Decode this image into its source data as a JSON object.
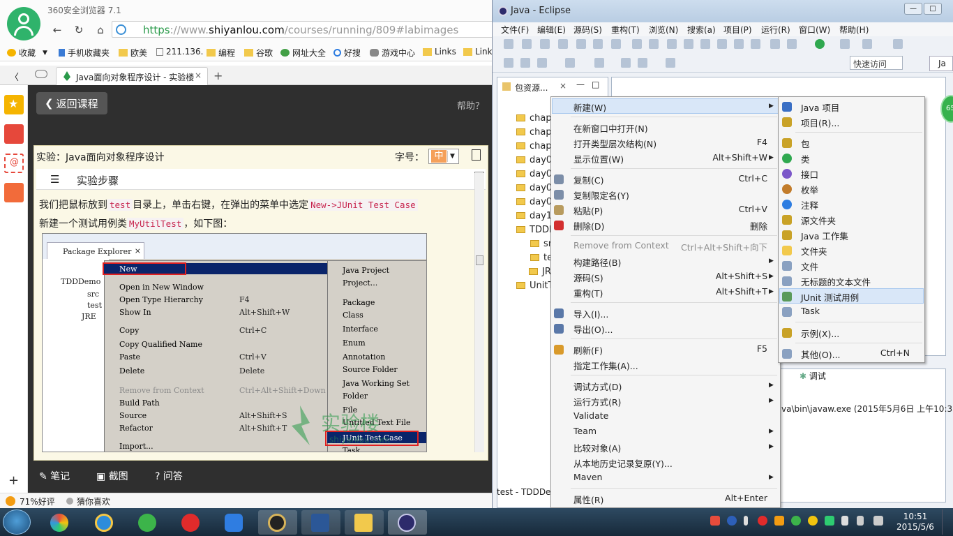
{
  "browser": {
    "title": "360安全浏览器 7.1",
    "url": {
      "scheme": "https",
      "sep": "://www.",
      "host": "shiyanlou.com",
      "path": "/courses/running/809#labimages"
    },
    "bookmarks": [
      "收藏",
      "手机收藏夹",
      "欧美",
      "211.136.",
      "编程",
      "谷歌",
      "网址大全",
      "好搜",
      "游戏中心",
      "Links",
      "Link"
    ],
    "tab_title": "Java面向对象程序设计 - 实验楼",
    "page": {
      "back_label": "返回课程",
      "help_label": "帮助？",
      "lab_title": "实验：Java面向对象程序设计",
      "font_label": "字号：",
      "font_value": "中",
      "steps_label": "实验步骤",
      "para1_a": "我们把鼠标放到",
      "para1_code1": "test",
      "para1_b": "目录上，单击右键，在弹出的菜单中选定",
      "para1_code2": "New->JUnit Test Case",
      "para2_a": "新建一个测试用例类",
      "para2_code": "MyUtilTest",
      "para2_b": "，如下图："
    },
    "bottom": {
      "notes": "笔记",
      "screenshot": "截图",
      "qa": "问答"
    },
    "status": {
      "rating": "71%好评",
      "guess": "猜你喜欢"
    },
    "inner_screenshot": {
      "tab": "Package Explorer",
      "tree": [
        "TDDDemo",
        "src",
        "test",
        "JRE"
      ],
      "menu1": [
        {
          "l": "New",
          "s": ""
        },
        {
          "l": "Open in New Window",
          "s": ""
        },
        {
          "l": "Open Type Hierarchy",
          "s": "F4"
        },
        {
          "l": "Show In",
          "s": "Alt+Shift+W"
        },
        {
          "l": "Copy",
          "s": "Ctrl+C"
        },
        {
          "l": "Copy Qualified Name",
          "s": ""
        },
        {
          "l": "Paste",
          "s": "Ctrl+V"
        },
        {
          "l": "Delete",
          "s": "Delete"
        },
        {
          "l": "Remove from Context",
          "s": "Ctrl+Alt+Shift+Down"
        },
        {
          "l": "Build Path",
          "s": ""
        },
        {
          "l": "Source",
          "s": "Alt+Shift+S"
        },
        {
          "l": "Refactor",
          "s": "Alt+Shift+T"
        },
        {
          "l": "Import...",
          "s": ""
        }
      ],
      "menu2": [
        "Java Project",
        "Project...",
        "Package",
        "Class",
        "Interface",
        "Enum",
        "Annotation",
        "Source Folder",
        "Java Working Set",
        "Folder",
        "File",
        "Untitled Text File",
        "JUnit Test Case",
        "Task"
      ]
    },
    "watermark": {
      "cn": "实验楼",
      "en": "shiyanlou.com"
    }
  },
  "eclipse": {
    "title": "Java - Eclipse",
    "menus": [
      "文件(F)",
      "编辑(E)",
      "源码(S)",
      "重构(T)",
      "浏览(N)",
      "搜索(a)",
      "项目(P)",
      "运行(R)",
      "窗口(W)",
      "帮助(H)"
    ],
    "quick_access": "快速访问",
    "perspective": "Ja",
    "pkg_tab": "包资源...",
    "tree": [
      "chap",
      "chap",
      "chap",
      "day0",
      "day0",
      "day0",
      "day0",
      "day1",
      "TDDI",
      "sr",
      "te",
      "JR",
      "UnitT"
    ],
    "console_tab": "调试",
    "console_line": "va\\bin\\javaw.exe (2015年5月6日 上午10:3",
    "status_text": "test - TDDDe",
    "badge": "65",
    "context_menu": [
      {
        "l": "新建(W)",
        "s": "",
        "sub": true
      },
      {
        "l": "在新窗口中打开(N)",
        "s": ""
      },
      {
        "l": "打开类型层次结构(N)",
        "s": "F4"
      },
      {
        "l": "显示位置(W)",
        "s": "Alt+Shift+W",
        "sub": true
      },
      {
        "l": "复制(C)",
        "s": "Ctrl+C"
      },
      {
        "l": "复制限定名(Y)",
        "s": ""
      },
      {
        "l": "粘贴(P)",
        "s": "Ctrl+V"
      },
      {
        "l": "删除(D)",
        "s": "删除"
      },
      {
        "l": "Remove from Context",
        "s": "Ctrl+Alt+Shift+向下",
        "dis": true
      },
      {
        "l": "构建路径(B)",
        "s": "",
        "sub": true
      },
      {
        "l": "源码(S)",
        "s": "Alt+Shift+S",
        "sub": true
      },
      {
        "l": "重构(T)",
        "s": "Alt+Shift+T",
        "sub": true
      },
      {
        "l": "导入(I)...",
        "s": ""
      },
      {
        "l": "导出(O)...",
        "s": ""
      },
      {
        "l": "刷新(F)",
        "s": "F5"
      },
      {
        "l": "指定工作集(A)...",
        "s": ""
      },
      {
        "l": "调试方式(D)",
        "s": "",
        "sub": true
      },
      {
        "l": "运行方式(R)",
        "s": "",
        "sub": true
      },
      {
        "l": "Validate",
        "s": ""
      },
      {
        "l": "Team",
        "s": "",
        "sub": true
      },
      {
        "l": "比较对象(A)",
        "s": "",
        "sub": true
      },
      {
        "l": "从本地历史记录复原(Y)...",
        "s": ""
      },
      {
        "l": "Maven",
        "s": "",
        "sub": true
      },
      {
        "l": "属性(R)",
        "s": "Alt+Enter"
      }
    ],
    "submenu": [
      {
        "l": "Java 项目",
        "s": ""
      },
      {
        "l": "项目(R)...",
        "s": ""
      },
      {
        "l": "包",
        "s": ""
      },
      {
        "l": "类",
        "s": ""
      },
      {
        "l": "接口",
        "s": ""
      },
      {
        "l": "枚举",
        "s": ""
      },
      {
        "l": "注释",
        "s": ""
      },
      {
        "l": "源文件夹",
        "s": ""
      },
      {
        "l": "Java 工作集",
        "s": ""
      },
      {
        "l": "文件夹",
        "s": ""
      },
      {
        "l": "文件",
        "s": ""
      },
      {
        "l": "无标题的文本文件",
        "s": ""
      },
      {
        "l": "JUnit 测试用例",
        "s": ""
      },
      {
        "l": "Task",
        "s": ""
      },
      {
        "l": "示例(X)...",
        "s": ""
      },
      {
        "l": "其他(O)...",
        "s": "Ctrl+N"
      }
    ]
  },
  "taskbar": {
    "time": "10:51",
    "date": "2015/5/6"
  },
  "colors": {
    "accent": "#2fb36b",
    "eclipse_title": "#cdddee",
    "selected": "#d9e7f8",
    "taskbar": "#1d3447"
  }
}
